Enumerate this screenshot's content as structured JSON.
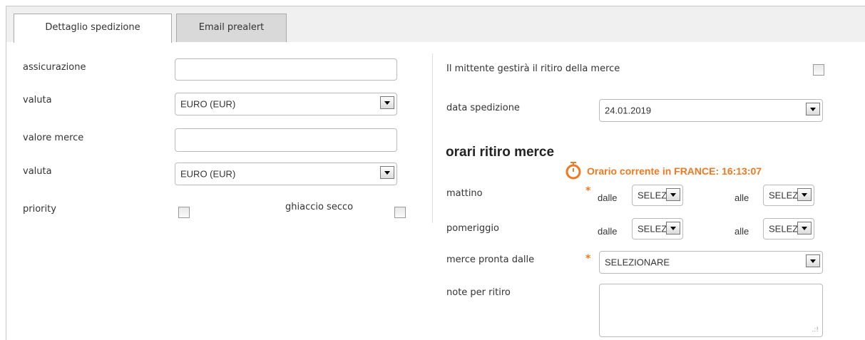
{
  "tabs": [
    {
      "label": "Dettaglio spedizione",
      "active": true
    },
    {
      "label": "Email prealert",
      "active": false
    }
  ],
  "left": {
    "assicurazione_label": "assicurazione",
    "assicurazione_value": "",
    "valuta1_label": "valuta",
    "valuta1_value": "EURO (EUR)",
    "valore_label": "valore merce",
    "valore_value": "",
    "valuta2_label": "valuta",
    "valuta2_value": "EURO (EUR)",
    "priority_label": "priority",
    "ghiaccio_label": "ghiaccio secco"
  },
  "right": {
    "mittente_label": "Il mittente gestirà il ritiro della merce",
    "data_label": "data spedizione",
    "data_value": "24.01.2019",
    "orari_heading": "orari ritiro merce",
    "orario_corrente": "Orario corrente in  FRANCE: 16:13:07",
    "mattino_label": "mattino",
    "pomeriggio_label": "pomeriggio",
    "dalle": "dalle",
    "alle": "alle",
    "time_select_value": "SELEZIONARE",
    "pronta_label": "merce pronta dalle",
    "pronta_value": "SELEZIONARE",
    "note_label": "note per ritiro",
    "required_mark": "*"
  },
  "colors": {
    "accent": "#f07820",
    "tab_inactive": "#d9d9d9",
    "border": "#bbbbbb"
  }
}
